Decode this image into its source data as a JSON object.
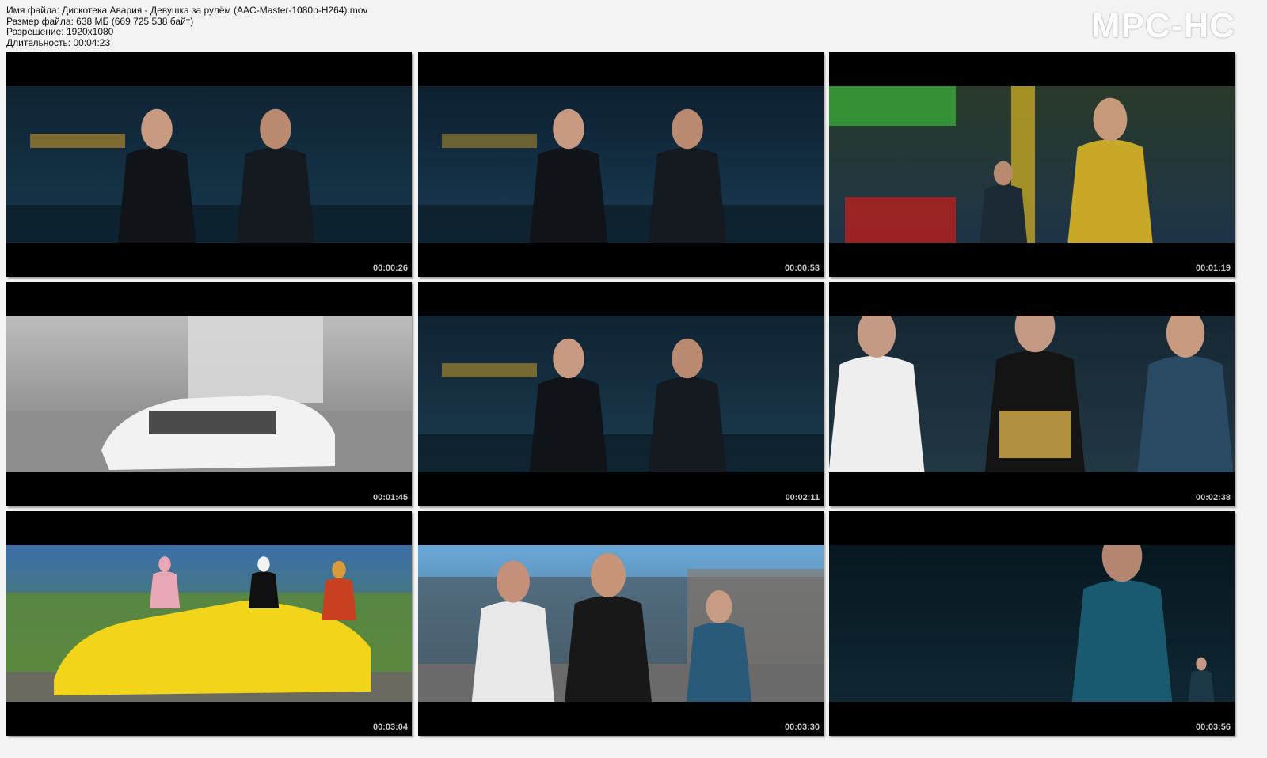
{
  "header": {
    "filename_line": "Имя файла: Дискотека Авария - Девушка за рулём (AAC-Master-1080p-H264).mov",
    "filesize_line": "Размер файла: 638 МБ (669 725 538 байт)",
    "resolution_line": "Разрешение: 1920x1080",
    "duration_line": "Длительность: 00:04:23",
    "logo": "MPC-HC"
  },
  "thumbnails": [
    {
      "timestamp": "00:00:26",
      "scene": "blue",
      "top": "#0e2433",
      "mid": "#17384e",
      "accent": "#c8962a"
    },
    {
      "timestamp": "00:00:53",
      "scene": "blue",
      "top": "#0c2030",
      "mid": "#1a3a52",
      "accent": "#a88a30"
    },
    {
      "timestamp": "00:01:19",
      "scene": "garage",
      "top": "#2a3a2a",
      "mid": "#1d3448",
      "accent": "#d8b520"
    },
    {
      "timestamp": "00:01:45",
      "scene": "bw",
      "top": "#bcbcbc",
      "mid": "#7a7a7a",
      "accent": "#f2f2f2"
    },
    {
      "timestamp": "00:02:11",
      "scene": "blue",
      "top": "#0f2332",
      "mid": "#1c3c50",
      "accent": "#b8922a"
    },
    {
      "timestamp": "00:02:38",
      "scene": "people",
      "top": "#1a2e3a",
      "mid": "#2b4452",
      "accent": "#d8b04a"
    },
    {
      "timestamp": "00:03:04",
      "scene": "yellowcar",
      "top": "#3a6ea8",
      "mid": "#5c8a3a",
      "accent": "#f2d41a"
    },
    {
      "timestamp": "00:03:30",
      "scene": "junkyard",
      "top": "#6aa8d8",
      "mid": "#3e5a6a",
      "accent": "#e8e8e8"
    },
    {
      "timestamp": "00:03:56",
      "scene": "dark",
      "top": "#0a1c26",
      "mid": "#163644",
      "accent": "#2a6a80"
    }
  ]
}
